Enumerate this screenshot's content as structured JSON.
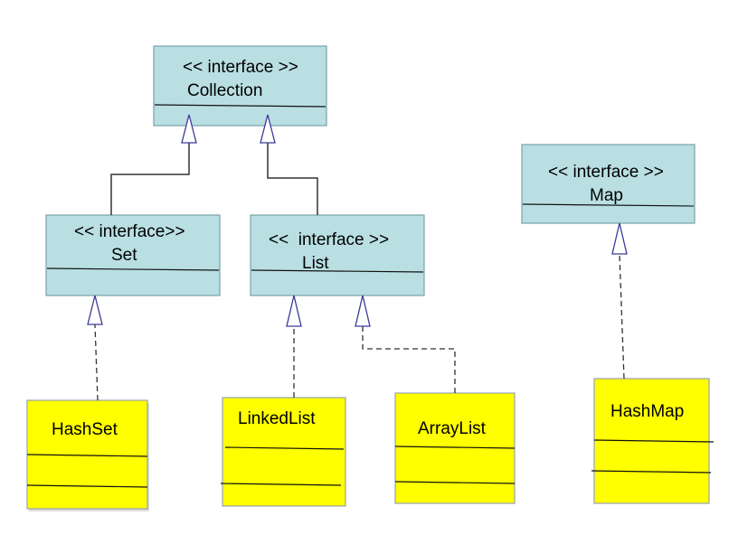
{
  "diagram": {
    "type": "UML class diagram",
    "colors": {
      "interface_fill": "#b9dfe3",
      "class_fill": "#ffff00",
      "arrowhead": "#3a3a9a"
    },
    "interfaces": [
      {
        "id": "collection",
        "stereotype": "<< interface >>",
        "name": "Collection"
      },
      {
        "id": "set",
        "stereotype": "<< interface>>",
        "name": "Set"
      },
      {
        "id": "list",
        "stereotype": "<<  interface >>",
        "name": "List"
      },
      {
        "id": "map",
        "stereotype": "<< interface >>",
        "name": "Map"
      }
    ],
    "classes": [
      {
        "id": "hashset",
        "name": "HashSet"
      },
      {
        "id": "linkedlist",
        "name": "LinkedList"
      },
      {
        "id": "arraylist",
        "name": "ArrayList"
      },
      {
        "id": "hashmap",
        "name": "HashMap"
      }
    ],
    "relations": [
      {
        "from": "Set",
        "to": "Collection",
        "kind": "generalization"
      },
      {
        "from": "List",
        "to": "Collection",
        "kind": "generalization"
      },
      {
        "from": "HashSet",
        "to": "Set",
        "kind": "realization"
      },
      {
        "from": "LinkedList",
        "to": "List",
        "kind": "realization"
      },
      {
        "from": "ArrayList",
        "to": "List",
        "kind": "realization"
      },
      {
        "from": "HashMap",
        "to": "Map",
        "kind": "realization"
      }
    ]
  }
}
